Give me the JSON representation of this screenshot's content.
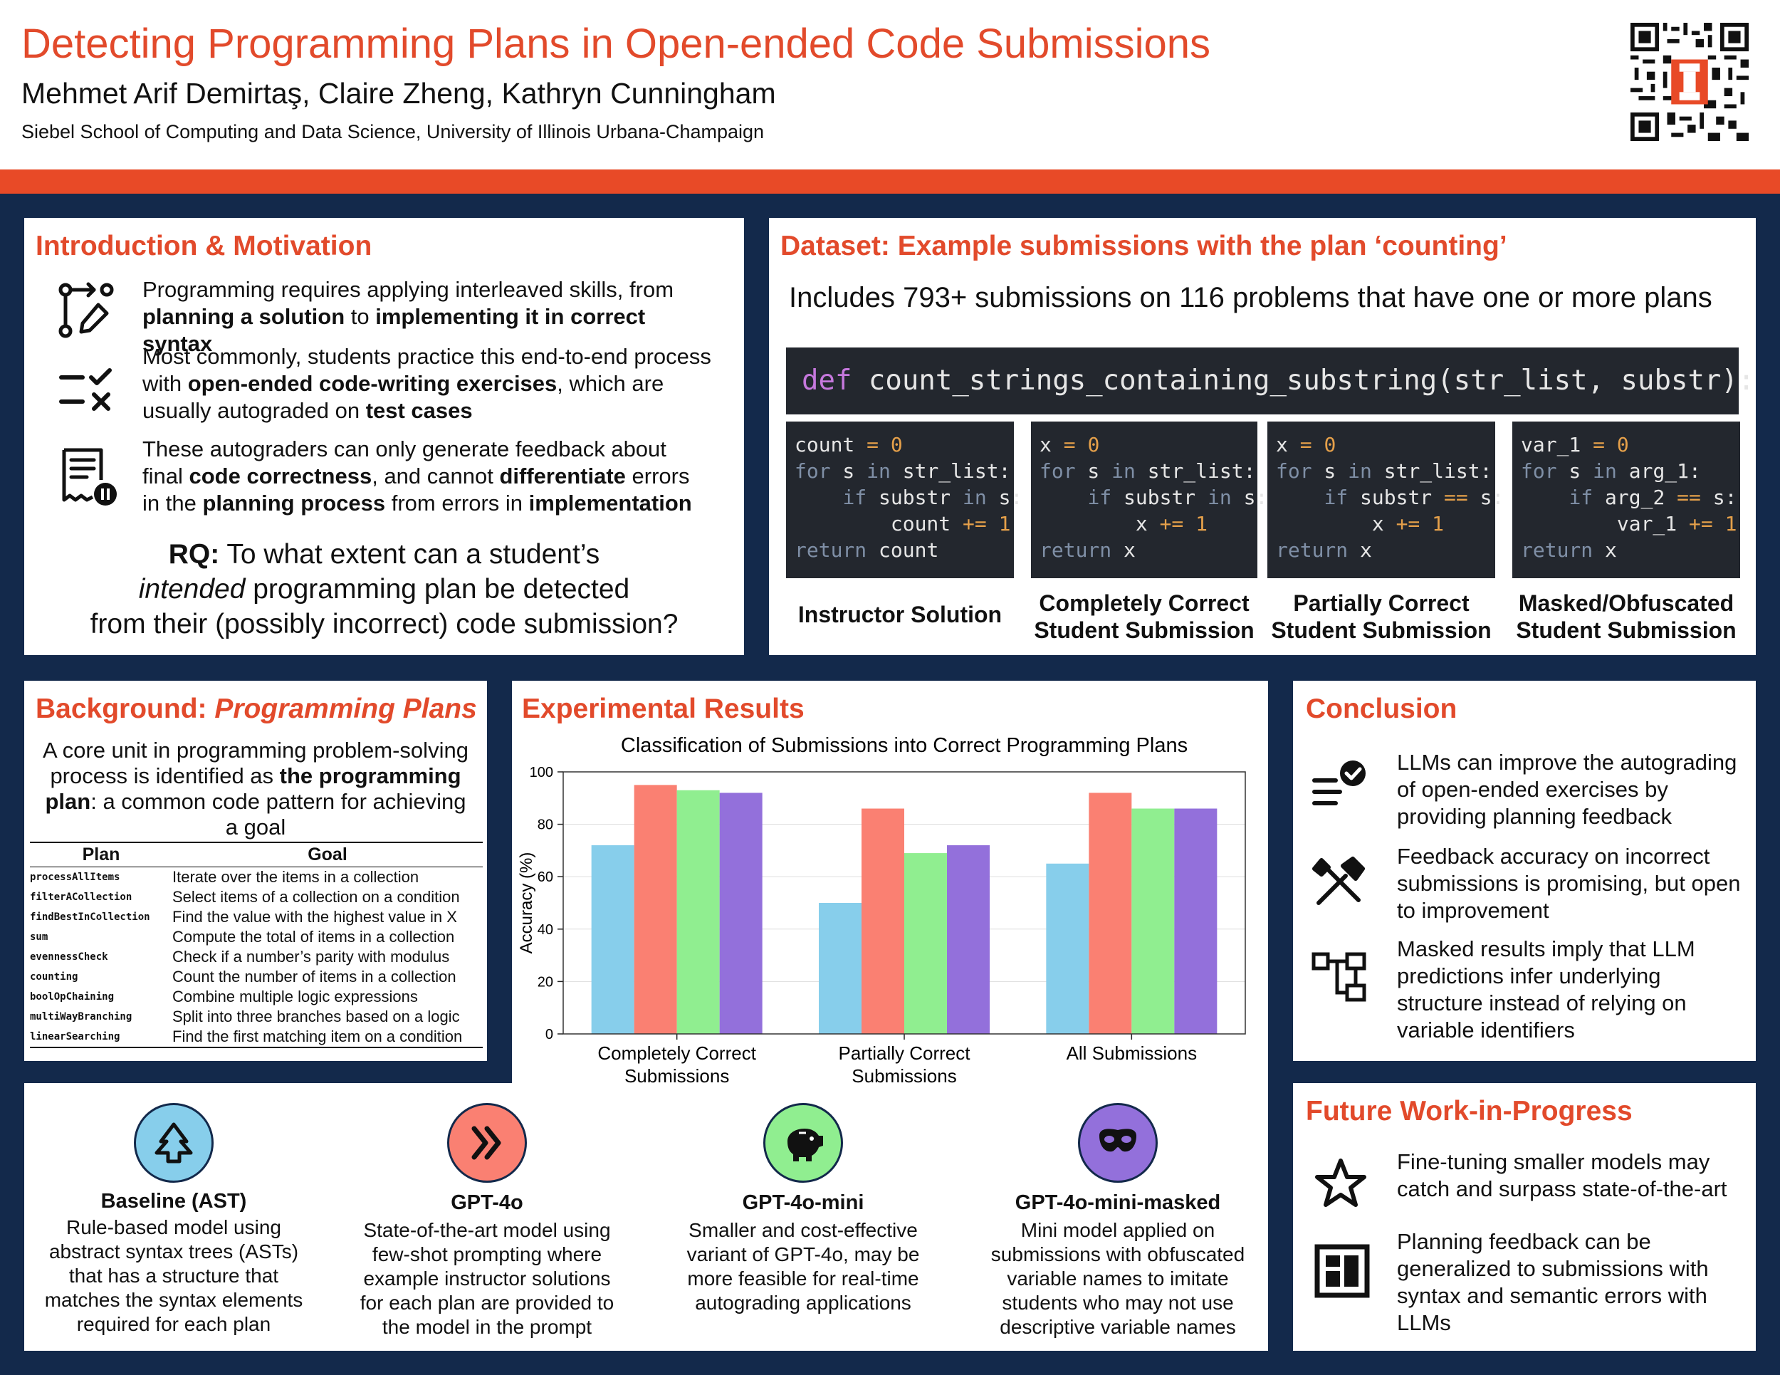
{
  "header": {
    "title": "Detecting Programming Plans in Open-ended Code Submissions",
    "authors": "Mehmet Arif Demirtaş, Claire Zheng, Kathryn Cunningham",
    "affiliation": "Siebel School of Computing and Data Science, University of Illinois Urbana-Champaign"
  },
  "intro": {
    "title": "Introduction & Motivation",
    "p1": [
      {
        "t": "Programming requires applying interleaved skills, from "
      },
      {
        "b": "planning a solution"
      },
      {
        "t": " to "
      },
      {
        "b": "implementing it in correct syntax"
      }
    ],
    "p2": [
      {
        "t": "Most commonly, students practice this end-to-end process with "
      },
      {
        "b": "open-ended code-writing exercises"
      },
      {
        "t": ", which are usually autograded on "
      },
      {
        "b": "test cases"
      }
    ],
    "p3": [
      {
        "t": "These autograders can only generate feedback about final "
      },
      {
        "b": "code correctness"
      },
      {
        "t": ", and cannot "
      },
      {
        "b": "differentiate"
      },
      {
        "t": " errors in the "
      },
      {
        "b": "planning process"
      },
      {
        "t": " from errors in "
      },
      {
        "b": "implementation"
      }
    ],
    "rq_label": "RQ:",
    "rq_line1": " To what extent can a student’s",
    "rq_line2_em": "intended",
    "rq_line2": " programming plan be detected",
    "rq_line3": "from their (possibly incorrect) code submission?"
  },
  "dataset": {
    "title": "Dataset: Example submissions with the plan ‘counting’",
    "summary": "Includes 793+ submissions on 116 problems that have one or more plans",
    "signature_kw": "def",
    "signature": " count_strings_containing_substring(str_list, substr):",
    "examples": [
      {
        "caption": "Instructor Solution",
        "code": [
          [
            [
              "v",
              "count"
            ],
            [
              "o",
              " = "
            ],
            [
              "n",
              "0"
            ]
          ],
          [
            [
              "k",
              "for"
            ],
            [
              "v",
              " s "
            ],
            [
              "k",
              "in"
            ],
            [
              "v",
              " str_list:"
            ]
          ],
          [
            [
              "v",
              "    "
            ],
            [
              "k",
              "if"
            ],
            [
              "v",
              " substr "
            ],
            [
              "k",
              "in"
            ],
            [
              "v",
              " s:"
            ]
          ],
          [
            [
              "v",
              "        count "
            ],
            [
              "o",
              "+="
            ],
            [
              "n",
              " 1"
            ]
          ],
          [
            [
              "k",
              "return"
            ],
            [
              "v",
              " count"
            ]
          ]
        ]
      },
      {
        "caption": "Completely Correct Student Submission",
        "code": [
          [
            [
              "v",
              "x"
            ],
            [
              "o",
              " = "
            ],
            [
              "n",
              "0"
            ]
          ],
          [
            [
              "k",
              "for"
            ],
            [
              "v",
              " s "
            ],
            [
              "k",
              "in"
            ],
            [
              "v",
              " str_list:"
            ]
          ],
          [
            [
              "v",
              "    "
            ],
            [
              "k",
              "if"
            ],
            [
              "v",
              " substr "
            ],
            [
              "k",
              "in"
            ],
            [
              "v",
              " s:"
            ]
          ],
          [
            [
              "v",
              "        x "
            ],
            [
              "o",
              "+="
            ],
            [
              "n",
              " 1"
            ]
          ],
          [
            [
              "k",
              "return"
            ],
            [
              "v",
              " x"
            ]
          ]
        ]
      },
      {
        "caption": "Partially Correct Student Submission",
        "code": [
          [
            [
              "v",
              "x"
            ],
            [
              "o",
              " = "
            ],
            [
              "n",
              "0"
            ]
          ],
          [
            [
              "k",
              "for"
            ],
            [
              "v",
              " s "
            ],
            [
              "k",
              "in"
            ],
            [
              "v",
              " str_list:"
            ]
          ],
          [
            [
              "v",
              "    "
            ],
            [
              "k",
              "if"
            ],
            [
              "v",
              " substr "
            ],
            [
              "o",
              "=="
            ],
            [
              "v",
              " s:"
            ]
          ],
          [
            [
              "v",
              "        x "
            ],
            [
              "o",
              "+="
            ],
            [
              "n",
              " 1"
            ]
          ],
          [
            [
              "k",
              "return"
            ],
            [
              "v",
              " x"
            ]
          ]
        ]
      },
      {
        "caption": "Masked/Obfuscated Student Submission",
        "code": [
          [
            [
              "v",
              "var_1"
            ],
            [
              "o",
              " = "
            ],
            [
              "n",
              "0"
            ]
          ],
          [
            [
              "k",
              "for"
            ],
            [
              "v",
              " s "
            ],
            [
              "k",
              "in"
            ],
            [
              "v",
              " arg_1:"
            ]
          ],
          [
            [
              "v",
              "    "
            ],
            [
              "k",
              "if"
            ],
            [
              "v",
              " arg_2 "
            ],
            [
              "o",
              "=="
            ],
            [
              "v",
              " s:"
            ]
          ],
          [
            [
              "v",
              "        var_1 "
            ],
            [
              "o",
              "+="
            ],
            [
              "n",
              " 1"
            ]
          ],
          [
            [
              "k",
              "return"
            ],
            [
              "v",
              " x"
            ]
          ]
        ]
      }
    ]
  },
  "background": {
    "title_plain": "Background: ",
    "title_em": "Programming Plans",
    "desc": [
      {
        "t": "A core unit in programming problem-solving process is identified as "
      },
      {
        "b": "the programming plan"
      },
      {
        "t": ": a common code pattern for achieving a goal"
      }
    ],
    "col_plan": "Plan",
    "col_goal": "Goal",
    "rows": [
      {
        "plan": "processAllItems",
        "goal": "Iterate over the items in a collection"
      },
      {
        "plan": "filterACollection",
        "goal": "Select items of a collection on a condition"
      },
      {
        "plan": "findBestInCollection",
        "goal": "Find the value with the highest value in X"
      },
      {
        "plan": "sum",
        "goal": "Compute the total of items in a collection"
      },
      {
        "plan": "evennessCheck",
        "goal": "Check if a number’s parity with modulus"
      },
      {
        "plan": "counting",
        "goal": "Count the number of items in a collection"
      },
      {
        "plan": "boolOpChaining",
        "goal": "Combine multiple logic expressions"
      },
      {
        "plan": "multiWayBranching",
        "goal": "Split into three branches based on a logic"
      },
      {
        "plan": "linearSearching",
        "goal": "Find the first matching item on a condition"
      }
    ]
  },
  "results": {
    "title": "Experimental Results"
  },
  "chart_data": {
    "type": "bar",
    "title": "Classification of Submissions into Correct Programming Plans",
    "xlabel": "",
    "ylabel": "Accuracy (%)",
    "ylim": [
      0,
      100
    ],
    "yticks": [
      0,
      20,
      40,
      60,
      80,
      100
    ],
    "categories": [
      [
        "Completely Correct",
        "Submissions"
      ],
      [
        "Partially Correct",
        "Submissions"
      ],
      [
        "All Submissions"
      ]
    ],
    "grid": true,
    "legend": "none",
    "series": [
      {
        "color": "#87ceeb",
        "values": [
          72,
          50,
          65
        ]
      },
      {
        "color": "#fa8072",
        "values": [
          95,
          86,
          92
        ]
      },
      {
        "color": "#90ee90",
        "values": [
          93,
          69,
          86
        ]
      },
      {
        "color": "#9370db",
        "values": [
          92,
          72,
          86
        ]
      }
    ]
  },
  "models": [
    {
      "name": "Baseline (AST)",
      "desc": [
        "Rule-based model using",
        "abstract syntax trees (ASTs)",
        "that has a structure that",
        "matches the syntax elements",
        "required for each plan"
      ],
      "color": "#87ceeb",
      "icon": "tree-icon"
    },
    {
      "name": "GPT-4o",
      "desc": [
        "State-of-the-art model using",
        "few-shot prompting where",
        "example instructor solutions",
        "for each plan are provided to",
        "the model in the prompt"
      ],
      "color": "#fa8072",
      "icon": "double-chevron-icon"
    },
    {
      "name": "GPT-4o-mini",
      "desc": [
        "Smaller and cost-effective",
        "variant of GPT-4o, may be",
        "more feasible for real-time",
        "autograding applications"
      ],
      "color": "#90ee90",
      "icon": "piggy-bank-icon"
    },
    {
      "name": "GPT-4o-mini-masked",
      "desc": [
        "Mini model applied on",
        "submissions with obfuscated",
        "variable names to imitate",
        "students who may not use",
        "descriptive variable names"
      ],
      "color": "#9370db",
      "icon": "mask-icon"
    }
  ],
  "conclusion": {
    "title": "Conclusion",
    "items": [
      "LLMs can improve the autograding of open-ended exercises by providing planning feedback",
      "Feedback accuracy on incorrect submissions is promising, but open to improvement",
      "Masked results imply that LLM predictions infer underlying structure instead of relying on variable identifiers"
    ]
  },
  "future": {
    "title": "Future Work-in-Progress",
    "items": [
      "Fine-tuning smaller models may catch and surpass state-of-the-art",
      "Planning feedback can be generalized to submissions with syntax and semantic errors with LLMs"
    ]
  }
}
